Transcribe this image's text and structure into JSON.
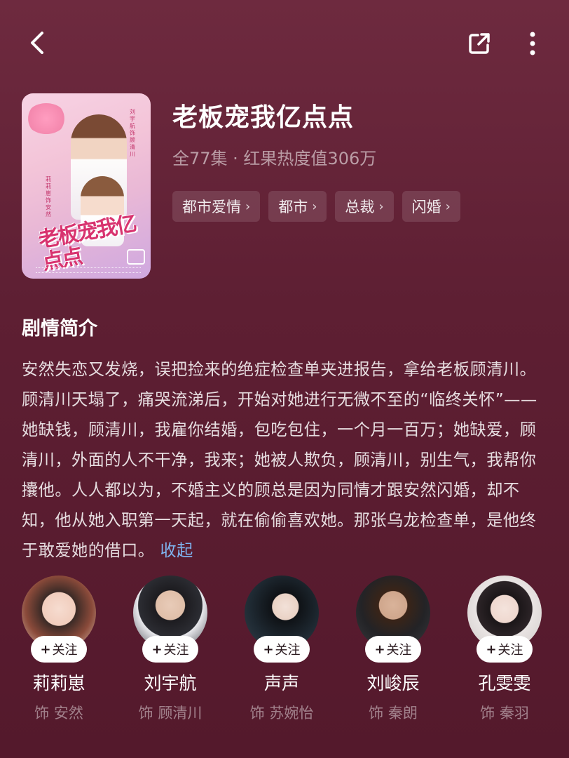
{
  "topbar": {
    "back_icon": "chevron-left-icon",
    "share_icon": "share-icon",
    "more_icon": "more-vertical-icon"
  },
  "drama": {
    "title": "老板宠我亿点点",
    "meta": "全77集 · 红果热度值306万",
    "tags": [
      {
        "label": "都市爱情"
      },
      {
        "label": "都市"
      },
      {
        "label": "总裁"
      },
      {
        "label": "闪婚"
      }
    ],
    "poster": {
      "logo_text": "老板宠我亿点点",
      "credit_male": "刘宇航 饰 顾清川",
      "credit_female": "莉莉崽 饰 安然"
    }
  },
  "synopsis": {
    "heading": "剧情简介",
    "text": "安然失恋又发烧，误把捡来的绝症检查单夹进报告，拿给老板顾清川。顾清川天塌了，痛哭流涕后，开始对她进行无微不至的“临终关怀”——她缺钱，顾清川，我雇你结婚，包吃包住，一个月一百万；她缺爱，顾清川，外面的人不干净，我来；她被人欺负，顾清川，别生气，我帮你攮他。人人都以为，不婚主义的顾总是因为同情才跟安然闪婚，却不知，他从她入职第一天起，就在偷偷喜欢她。那张乌龙检查单，是他终于敢爱她的借口。",
    "collapse_label": "收起"
  },
  "cast": [
    {
      "name": "莉莉崽",
      "role": "饰 安然",
      "follow": "关注",
      "color": "#e8c6b8"
    },
    {
      "name": "刘宇航",
      "role": "饰 顾清川",
      "follow": "关注",
      "color": "#3a3a42"
    },
    {
      "name": "声声",
      "role": "饰 苏婉怡",
      "follow": "关注",
      "color": "#2a3a44"
    },
    {
      "name": "刘峻辰",
      "role": "饰 秦朗",
      "follow": "关注",
      "color": "#2b2c30"
    },
    {
      "name": "孔雯雯",
      "role": "饰 秦羽",
      "follow": "关注",
      "color": "#d9d4d4"
    }
  ]
}
